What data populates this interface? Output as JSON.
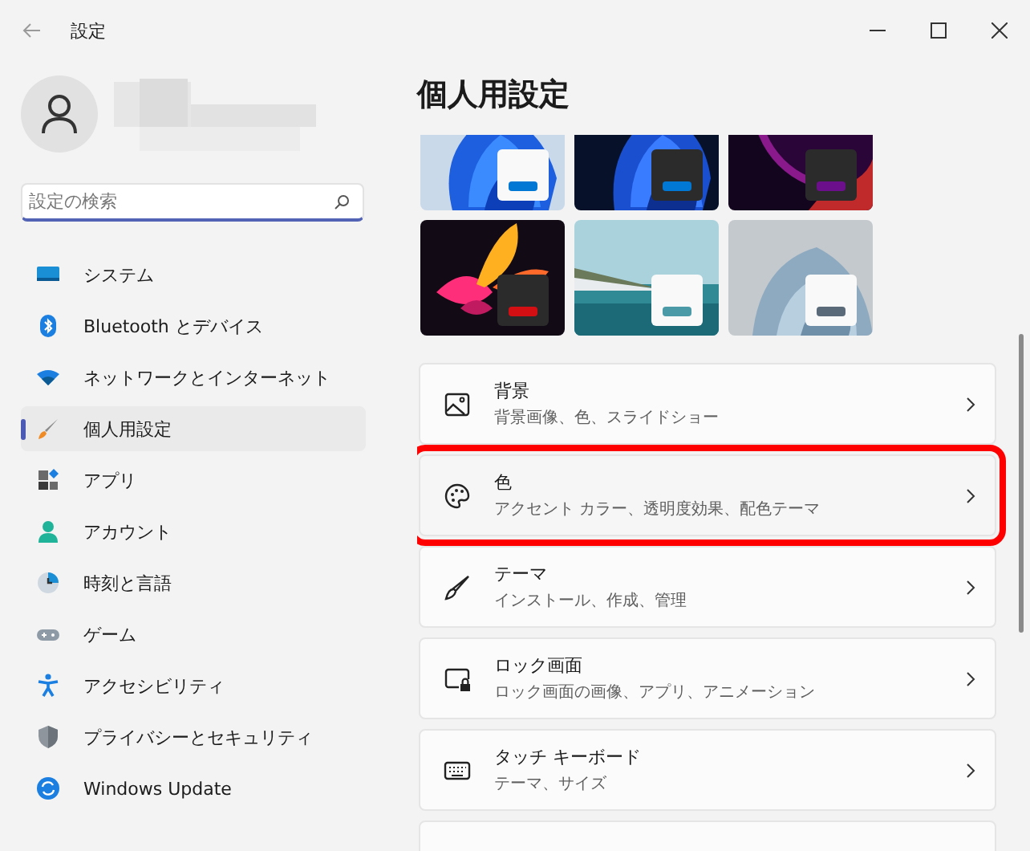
{
  "window": {
    "title": "設定"
  },
  "search": {
    "placeholder": "設定の検索"
  },
  "nav": [
    {
      "label": "システム",
      "selected": false
    },
    {
      "label": "Bluetooth とデバイス",
      "selected": false
    },
    {
      "label": "ネットワークとインターネット",
      "selected": false
    },
    {
      "label": "個人用設定",
      "selected": true
    },
    {
      "label": "アプリ",
      "selected": false
    },
    {
      "label": "アカウント",
      "selected": false
    },
    {
      "label": "時刻と言語",
      "selected": false
    },
    {
      "label": "ゲーム",
      "selected": false
    },
    {
      "label": "アクセシビリティ",
      "selected": false
    },
    {
      "label": "プライバシーとセキュリティ",
      "selected": false
    },
    {
      "label": "Windows Update",
      "selected": false
    }
  ],
  "page_title": "個人用設定",
  "themes": [
    {
      "kind": "picture",
      "dark": false,
      "color": "#0078d4"
    },
    {
      "kind": "picture",
      "dark": true,
      "color": "#0078d4"
    },
    {
      "kind": "picture",
      "dark": true,
      "color": "#6b0f8a"
    },
    {
      "kind": "picture",
      "dark": true,
      "color": "#d40f14"
    },
    {
      "kind": "picture",
      "dark": false,
      "color": "#4a9aa8"
    },
    {
      "kind": "picture",
      "dark": false,
      "color": "#5a6a78"
    }
  ],
  "settings": [
    {
      "title": "背景",
      "subtitle": "背景画像、色、スライドショー",
      "highlighted": false
    },
    {
      "title": "色",
      "subtitle": "アクセント カラー、透明度効果、配色テーマ",
      "highlighted": true
    },
    {
      "title": "テーマ",
      "subtitle": "インストール、作成、管理",
      "highlighted": false
    },
    {
      "title": "ロック画面",
      "subtitle": "ロック画面の画像、アプリ、アニメーション",
      "highlighted": false
    },
    {
      "title": "タッチ キーボード",
      "subtitle": "テーマ、サイズ",
      "highlighted": false
    }
  ]
}
